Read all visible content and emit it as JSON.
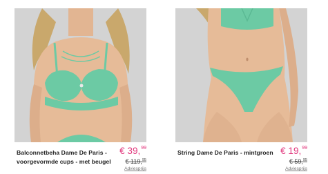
{
  "products": [
    {
      "title_line1": "Balconnetbeha Dame De Paris -",
      "title_line2": "voorgevormde cups - met beugel ...",
      "price_main": "€ 39,",
      "price_cents": "99",
      "old_price_main": "€ 119,",
      "old_price_cents": "95",
      "advice_label": "Adviesprijs",
      "image_alt": "Model wearing mint green balconette bra",
      "accent_color": "#6ccaa4"
    },
    {
      "title_line1": "String Dame De Paris - mintgroen",
      "title_line2": "",
      "price_main": "€ 19,",
      "price_cents": "99",
      "old_price_main": "€ 59,",
      "old_price_cents": "95",
      "advice_label": "Adviesprijs",
      "image_alt": "Model wearing mint green string",
      "accent_color": "#6ccaa4"
    }
  ],
  "colors": {
    "price": "#e0337a",
    "title": "#222222",
    "background": "#ffffff"
  }
}
